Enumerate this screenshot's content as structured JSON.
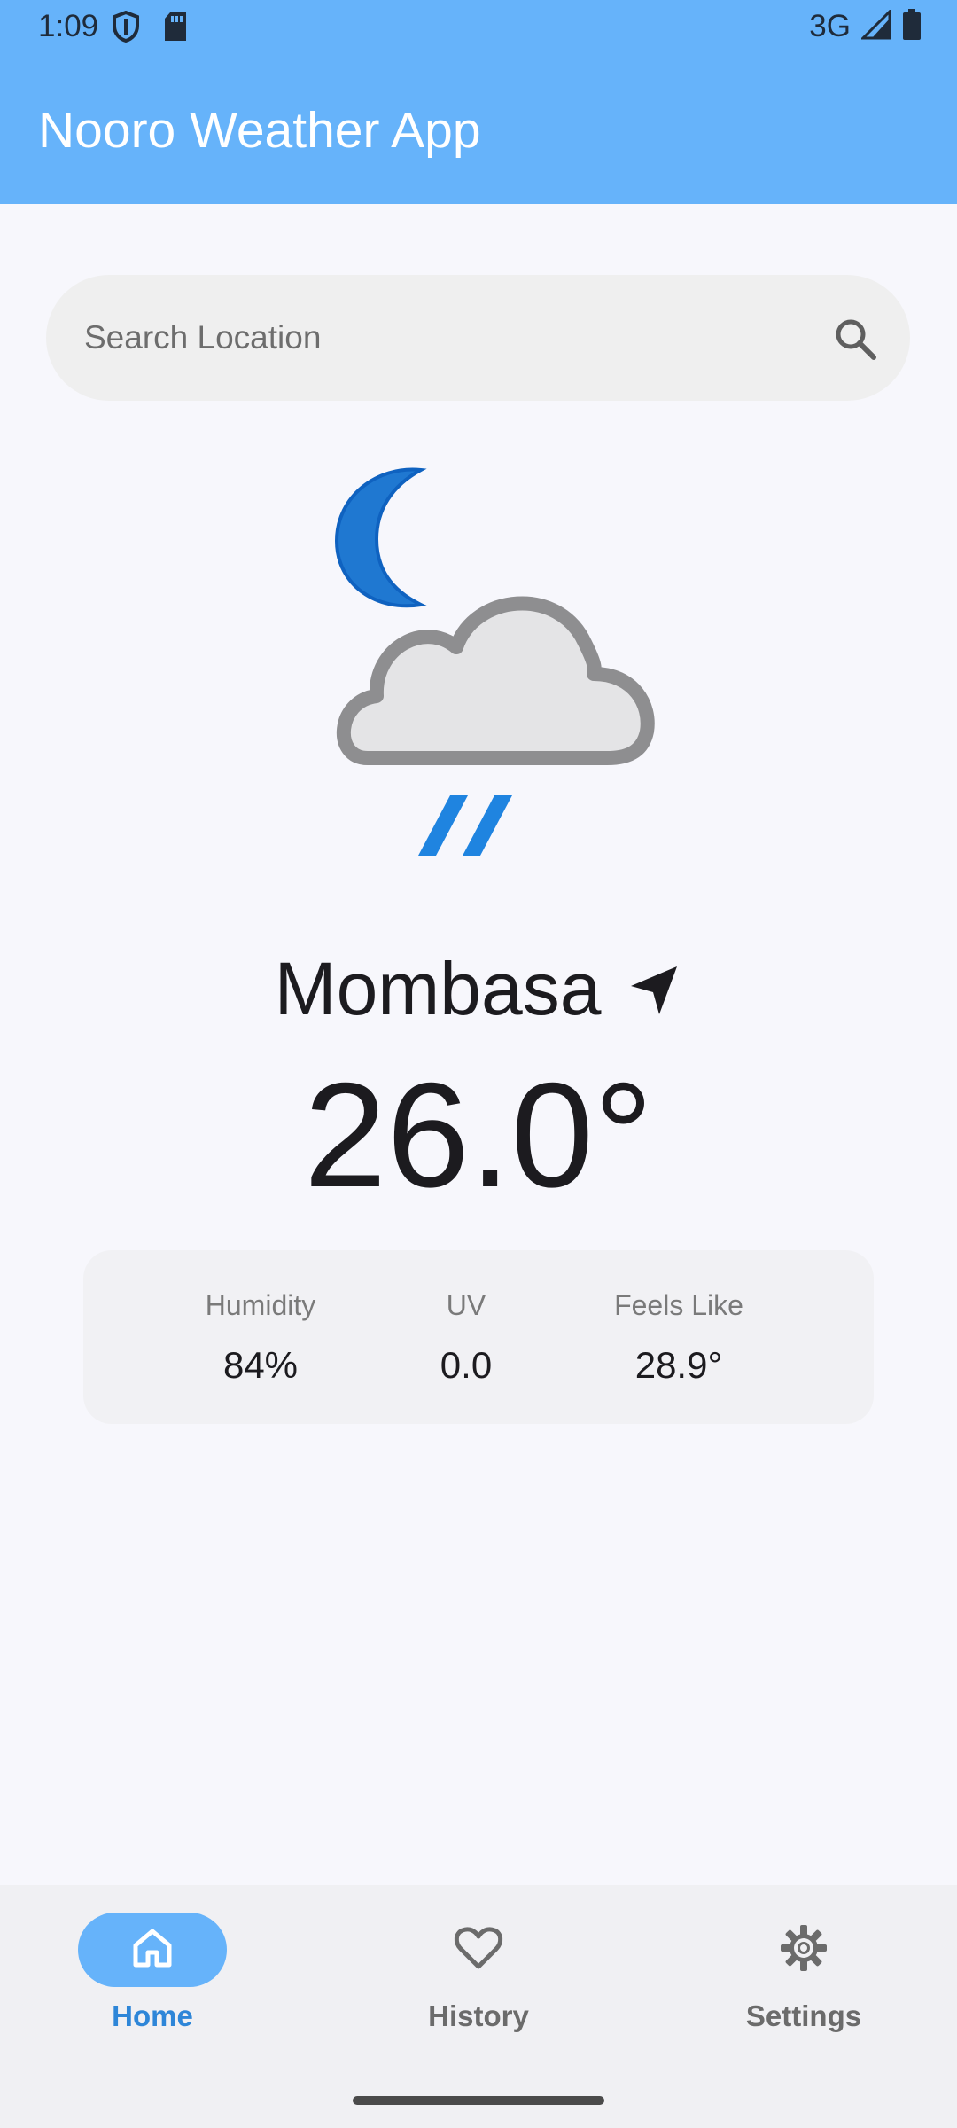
{
  "status_bar": {
    "time": "1:09",
    "network": "3G"
  },
  "header": {
    "title": "Nooro Weather App",
    "color": "#66b3fa"
  },
  "search": {
    "placeholder": "Search Location",
    "value": "",
    "icon": "search-icon"
  },
  "weather": {
    "condition_icon": "night-cloud-rain-icon",
    "city": "Mombasa",
    "location_icon": "navigation-arrow-icon",
    "temperature": "26.0°"
  },
  "stats": [
    {
      "label": "Humidity",
      "value": "84%"
    },
    {
      "label": "UV",
      "value": "0.0"
    },
    {
      "label": "Feels Like",
      "value": "28.9°"
    }
  ],
  "nav": {
    "items": [
      {
        "label": "Home",
        "icon": "home-icon",
        "active": true
      },
      {
        "label": "History",
        "icon": "heart-icon",
        "active": false
      },
      {
        "label": "Settings",
        "icon": "gear-icon",
        "active": false
      }
    ],
    "accent": "#2e86d8"
  }
}
